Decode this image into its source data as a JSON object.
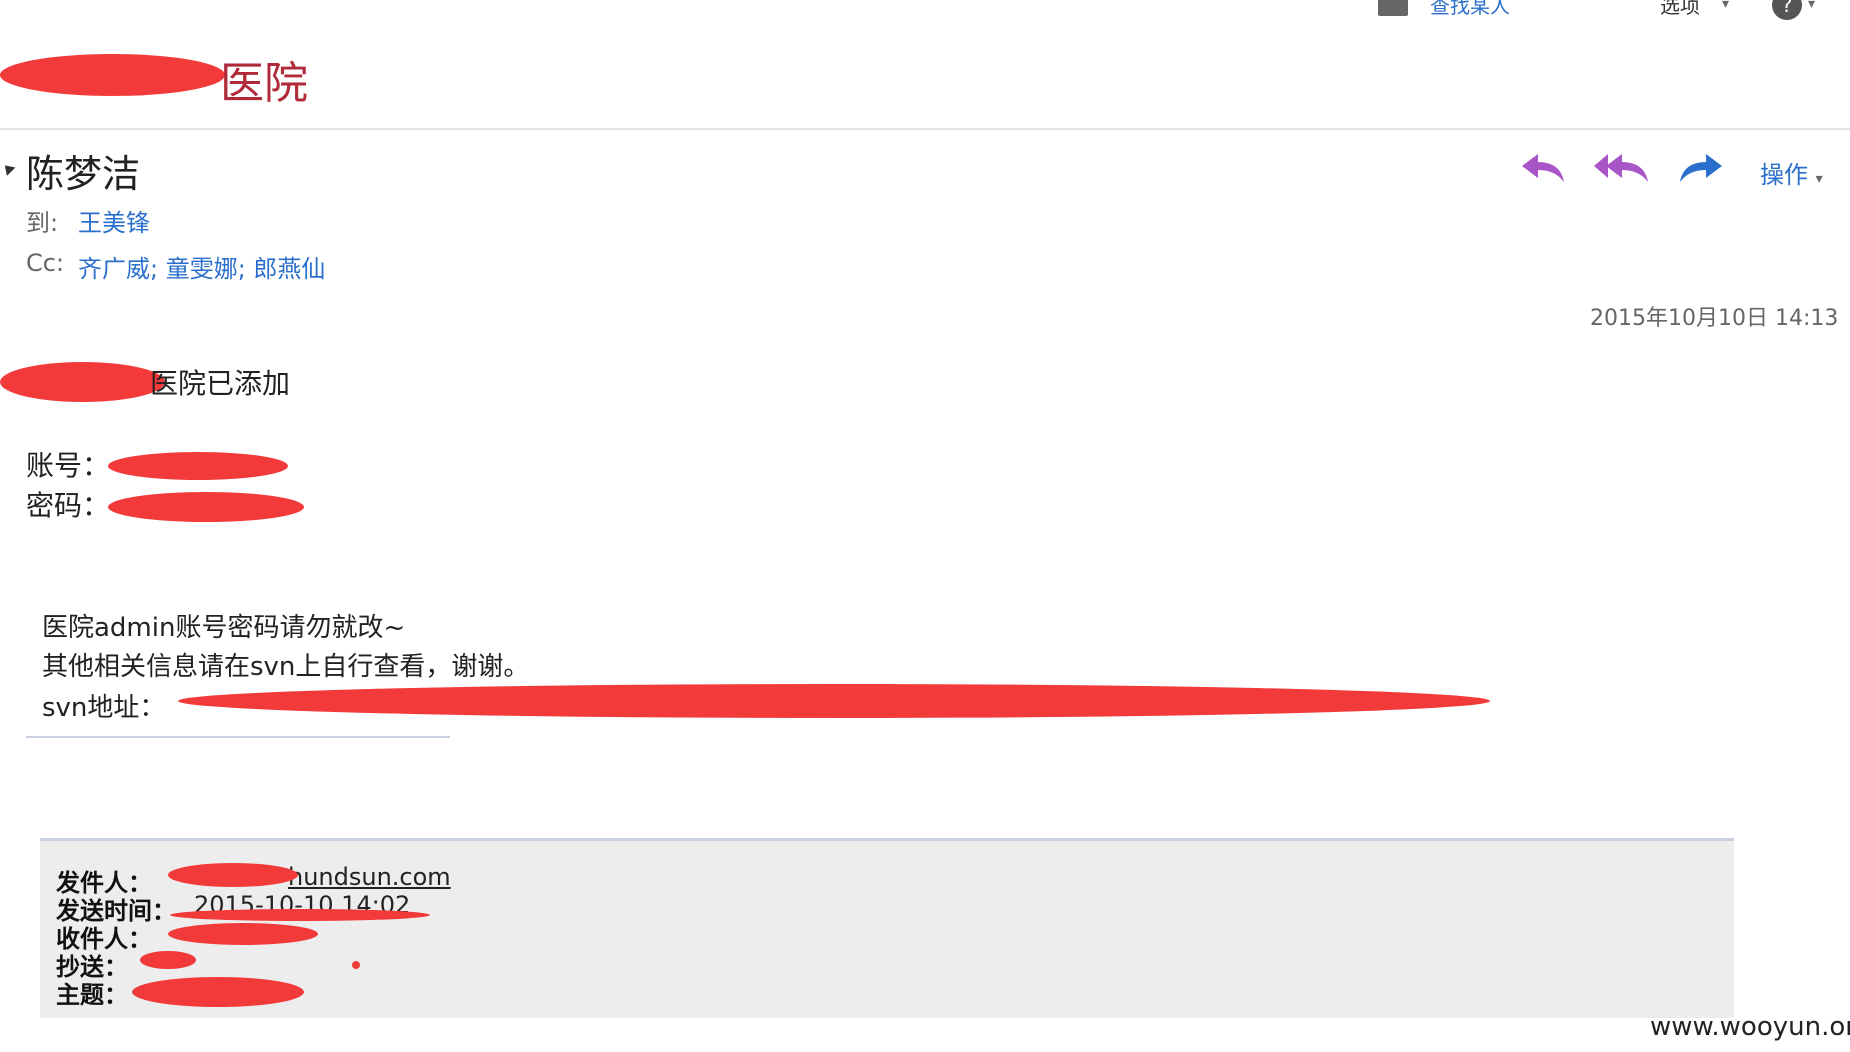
{
  "topbar": {
    "find_contacts": "查找某人",
    "options": "选项"
  },
  "header": {
    "title_suffix": "医院",
    "sender": "陈梦洁",
    "to_label": "到:",
    "to_value": "王美锋",
    "cc_label": "Cc:",
    "cc_value": "齐广威; 童雯娜; 郎燕仙",
    "operations": "操作",
    "timestamp": "2015年10月10日 14:13"
  },
  "body": {
    "line1_suffix": "医院已添加",
    "account_label": "账号：",
    "password_label": "密码：",
    "note1": "医院admin账号密码请勿就改~",
    "note2": "其他相关信息请在svn上自行查看，谢谢。",
    "svn_label": "svn地址："
  },
  "quote": {
    "from_label": "发件人：",
    "from_value": "hundsun.com",
    "sent_label": "发送时间：",
    "sent_value": "2015-10-10 14:02",
    "to_label": "收件人：",
    "cc_label": "抄送：",
    "subject_label": "主题："
  },
  "watermark": "www.wooyun.org",
  "colors": {
    "link": "#2a6fcc",
    "reply_arrow": "#a855c7",
    "forward_arrow": "#2a6fcc",
    "redaction": "#f23a3a"
  }
}
